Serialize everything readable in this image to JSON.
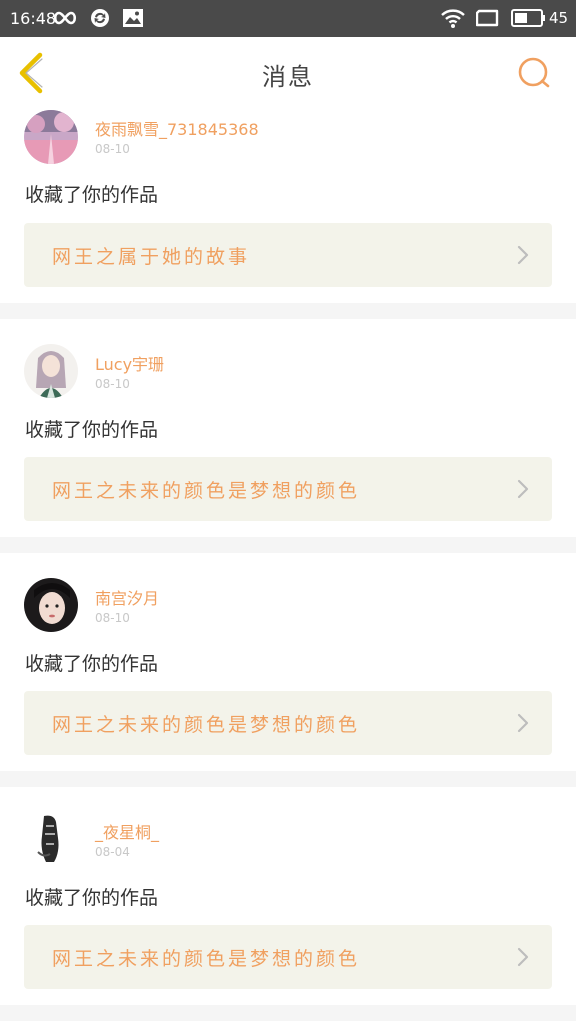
{
  "status": {
    "time": "16:48",
    "battery": "45"
  },
  "header": {
    "title": "消息"
  },
  "messages": [
    {
      "user": "夜雨飘雪_731845368",
      "date": "08-10",
      "action": "收藏了你的作品",
      "work_title": "网王之属于她的故事"
    },
    {
      "user": "Lucy宇珊",
      "date": "08-10",
      "action": "收藏了你的作品",
      "work_title": "网王之未来的颜色是梦想的颜色"
    },
    {
      "user": "南宫汐月",
      "date": "08-10",
      "action": "收藏了你的作品",
      "work_title": "网王之未来的颜色是梦想的颜色"
    },
    {
      "user": "_夜星桐_",
      "date": "08-04",
      "action": "收藏了你的作品",
      "work_title": "网王之未来的颜色是梦想的颜色"
    }
  ],
  "colors": {
    "accent": "#f0a060",
    "back_icon": "#e8c000",
    "card_bg": "#f3f3ea",
    "status_bar": "#4a4a4a"
  },
  "icons": [
    "infinity-icon",
    "sync-icon",
    "image-icon",
    "wifi-icon",
    "screen-icon",
    "battery-icon",
    "back-icon",
    "search-icon",
    "chevron-right-icon"
  ]
}
